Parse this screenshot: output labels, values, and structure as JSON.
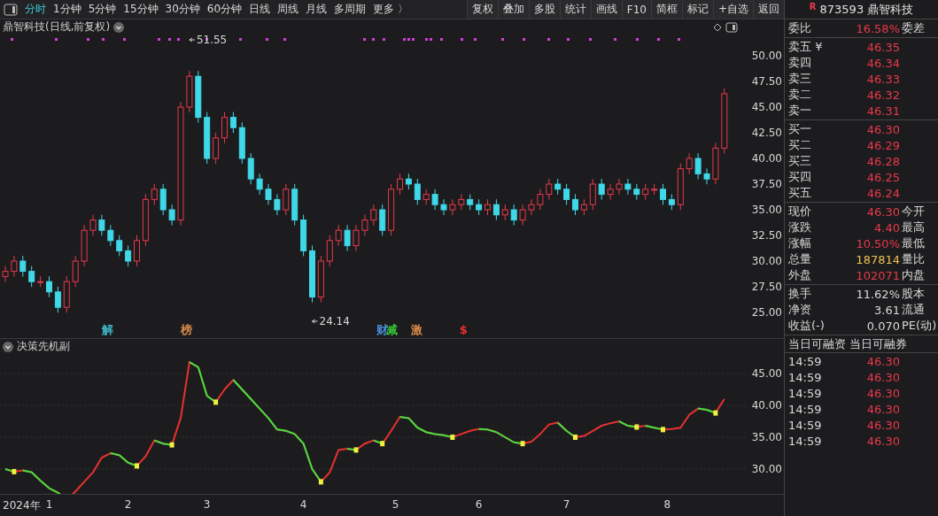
{
  "toolbar": {
    "tabs": [
      {
        "label": "分时",
        "selected": true
      },
      {
        "label": "1分钟",
        "selected": false
      },
      {
        "label": "5分钟",
        "selected": false
      },
      {
        "label": "15分钟",
        "selected": false
      },
      {
        "label": "30分钟",
        "selected": false
      },
      {
        "label": "60分钟",
        "selected": false
      },
      {
        "label": "日线",
        "selected": false
      },
      {
        "label": "周线",
        "selected": false
      },
      {
        "label": "月线",
        "selected": false
      },
      {
        "label": "多周期",
        "selected": false
      },
      {
        "label": "更多 〉",
        "selected": false
      }
    ],
    "buttons": [
      "复权",
      "叠加",
      "多股",
      "统计",
      "画线",
      "F10",
      "简框",
      "标记",
      "+自选",
      "返回"
    ]
  },
  "main_pane": {
    "title": "鼎智科技(日线,前复权)",
    "price_axis": [
      "50.00",
      "47.50",
      "45.00",
      "42.50",
      "40.00",
      "37.50",
      "35.00",
      "32.50",
      "30.00",
      "27.50",
      "25.00"
    ],
    "high_label": "51.55",
    "low_label": "24.14",
    "signals": [
      {
        "text": "解",
        "color": "#3fb7c8"
      },
      {
        "text": "榜",
        "color": "#d98c4a"
      },
      {
        "text": "财",
        "color": "#4a8ee0"
      },
      {
        "text": "减",
        "color": "#38c838"
      },
      {
        "text": "激",
        "color": "#d98c4a"
      },
      {
        "text": "$",
        "color": "#e83030"
      }
    ]
  },
  "sub_pane": {
    "title": "决策先机副",
    "value_axis": [
      "45.00",
      "40.00",
      "35.00",
      "30.00"
    ]
  },
  "x_axis": {
    "year_label": "2024年",
    "month_labels": [
      "1",
      "2",
      "3",
      "4",
      "5",
      "6",
      "7",
      "8"
    ]
  },
  "quote": {
    "badge": "R",
    "code": "873593",
    "name": "鼎智科技",
    "ratio": {
      "label": "委比",
      "value": "16.58%",
      "label2": "委差",
      "color": "#e8394a"
    },
    "asks": [
      {
        "label": "卖五 ¥",
        "price": "46.35"
      },
      {
        "label": "卖四",
        "price": "46.34"
      },
      {
        "label": "卖三",
        "price": "46.33"
      },
      {
        "label": "卖二",
        "price": "46.32"
      },
      {
        "label": "卖一",
        "price": "46.31"
      }
    ],
    "bids": [
      {
        "label": "买一",
        "price": "46.30"
      },
      {
        "label": "买二",
        "price": "46.29"
      },
      {
        "label": "买三",
        "price": "46.28"
      },
      {
        "label": "买四",
        "price": "46.25"
      },
      {
        "label": "买五",
        "price": "46.24"
      }
    ],
    "stats": [
      {
        "label": "现价",
        "value": "46.30",
        "label2": "今开",
        "color": "#e8394a"
      },
      {
        "label": "涨跌",
        "value": "4.40",
        "label2": "最高",
        "color": "#e8394a"
      },
      {
        "label": "涨幅",
        "value": "10.50%",
        "label2": "最低",
        "color": "#e8394a"
      },
      {
        "label": "总量",
        "value": "187814",
        "label2": "量比",
        "color": "#f0c050"
      },
      {
        "label": "外盘",
        "value": "102071",
        "label2": "内盘",
        "color": "#e8394a"
      }
    ],
    "finance": [
      {
        "label": "换手",
        "value": "11.62%",
        "label2": "股本",
        "color": "#d8d8d8"
      },
      {
        "label": "净资",
        "value": "3.61",
        "label2": "流通",
        "color": "#d8d8d8"
      },
      {
        "label": "收益(-)",
        "value": "0.070",
        "label2": "PE(动)",
        "color": "#d8d8d8"
      }
    ],
    "margin_headers": [
      "当日可融资",
      "当日可融券"
    ],
    "ticks": [
      {
        "time": "14:59",
        "price": "46.30"
      },
      {
        "time": "14:59",
        "price": "46.30"
      },
      {
        "time": "14:59",
        "price": "46.30"
      },
      {
        "time": "14:59",
        "price": "46.30"
      },
      {
        "time": "14:59",
        "price": "46.30"
      },
      {
        "time": "14:59",
        "price": "46.30"
      }
    ]
  }
}
